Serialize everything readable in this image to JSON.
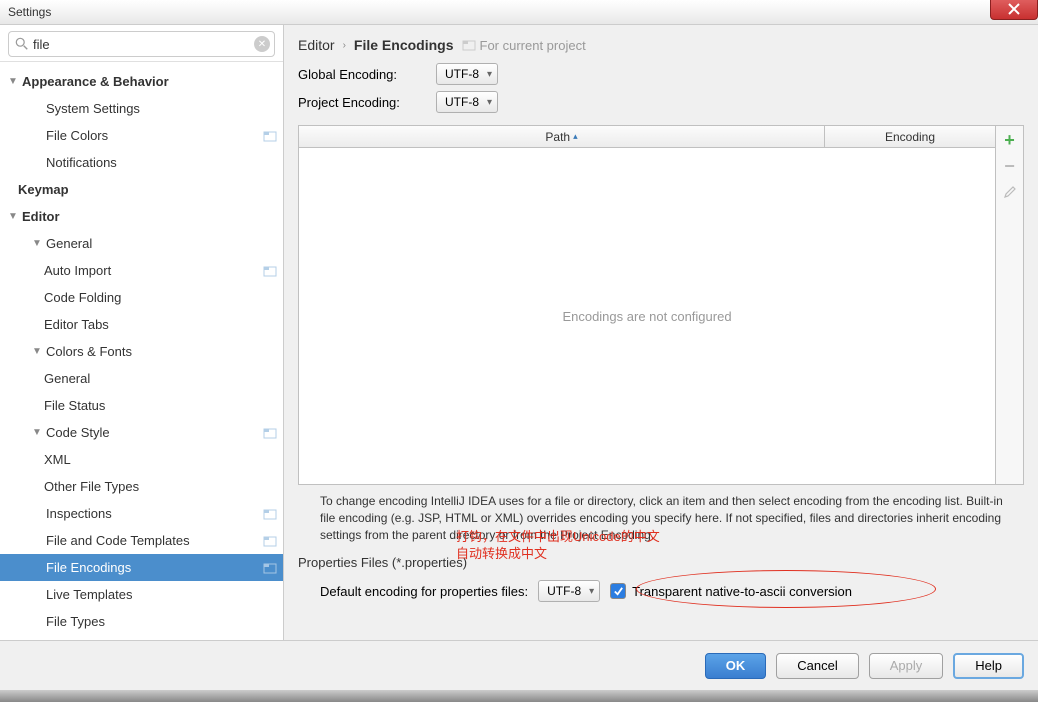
{
  "window": {
    "title": "Settings"
  },
  "search": {
    "value": "file"
  },
  "tree": {
    "appearance": "Appearance & Behavior",
    "systemSettings": "System Settings",
    "fileColors": "File Colors",
    "notifications": "Notifications",
    "keymap": "Keymap",
    "editor": "Editor",
    "general": "General",
    "autoImport": "Auto Import",
    "codeFolding": "Code Folding",
    "editorTabs": "Editor Tabs",
    "colorsFonts": "Colors & Fonts",
    "cfGeneral": "General",
    "fileStatus": "File Status",
    "codeStyle": "Code Style",
    "xml": "XML",
    "otherFileTypes": "Other File Types",
    "inspections": "Inspections",
    "fileCodeTemplates": "File and Code Templates",
    "fileEncodings": "File Encodings",
    "liveTemplates": "Live Templates",
    "fileTypes": "File Types"
  },
  "breadcrumb": {
    "editor": "Editor",
    "page": "File Encodings",
    "projectNote": "For current project"
  },
  "encodings": {
    "globalLabel": "Global Encoding:",
    "globalValue": "UTF-8",
    "projectLabel": "Project Encoding:",
    "projectValue": "UTF-8"
  },
  "table": {
    "colPath": "Path",
    "colEncoding": "Encoding",
    "empty": "Encodings are not configured"
  },
  "footnote": "To change encoding IntelliJ IDEA uses for a file or directory, click an item and then select encoding from the encoding list. Built-in file encoding (e.g. JSP, HTML or XML) overrides encoding you specify here. If not specified, files and directories inherit encoding settings from the parent directory or from the Project Encoding.",
  "props": {
    "section": "Properties Files (*.properties)",
    "defaultLabel": "Default encoding for properties files:",
    "defaultValue": "UTF-8",
    "transparent": "Transparent native-to-ascii conversion"
  },
  "annotation": {
    "line1": "打钩，在文件中出现Unicode的中文",
    "line2": "自动转换成中文"
  },
  "buttons": {
    "ok": "OK",
    "cancel": "Cancel",
    "apply": "Apply",
    "help": "Help"
  }
}
